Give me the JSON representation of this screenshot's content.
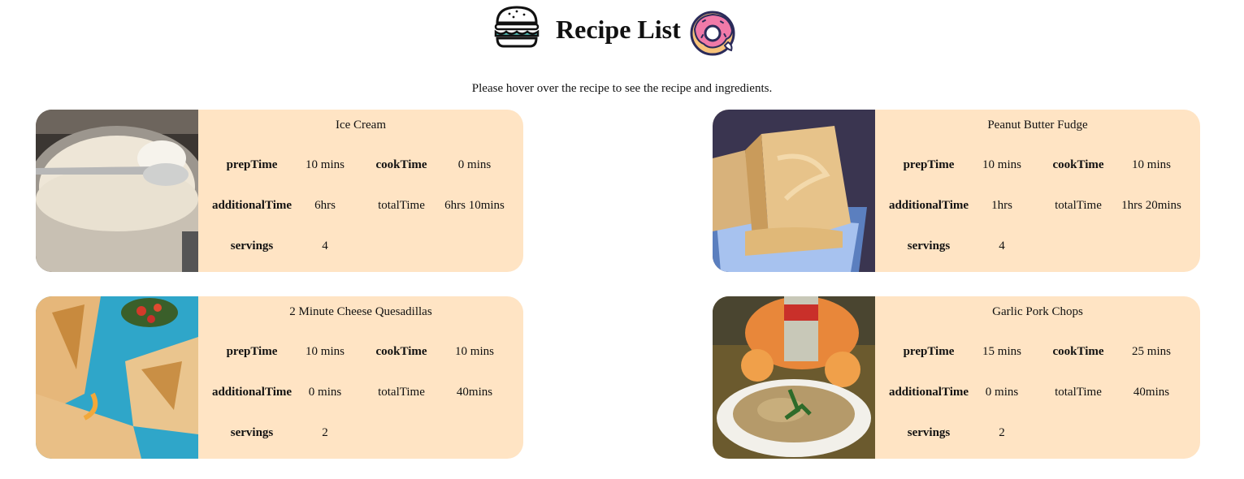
{
  "header": {
    "title": "Recipe List",
    "left_icon": "burger-icon",
    "right_icon": "donut-icon"
  },
  "subtitle": "Please hover over the recipe to see the recipe and ingredients.",
  "labels": {
    "prepTime": "prepTime",
    "cookTime": "cookTime",
    "additionalTime": "additionalTime",
    "totalTime": "totalTime",
    "servings": "servings"
  },
  "recipes": [
    {
      "name": "Ice Cream",
      "prepTime": "10 mins",
      "cookTime": "0 mins",
      "additionalTime": "6hrs",
      "totalTime": "6hrs 10mins",
      "servings": "4",
      "image": "ice-cream-jar-photo"
    },
    {
      "name": "Peanut Butter Fudge",
      "prepTime": "10 mins",
      "cookTime": "10 mins",
      "additionalTime": "1hrs",
      "totalTime": "1hrs 20mins",
      "servings": "4",
      "image": "fudge-photo"
    },
    {
      "name": "2 Minute Cheese Quesadillas",
      "prepTime": "10 mins",
      "cookTime": "10 mins",
      "additionalTime": "0 mins",
      "totalTime": "40mins",
      "servings": "2",
      "image": "quesadillas-photo"
    },
    {
      "name": "Garlic Pork Chops",
      "prepTime": "15 mins",
      "cookTime": "25 mins",
      "additionalTime": "0 mins",
      "totalTime": "40mins",
      "servings": "2",
      "image": "pork-chops-photo"
    }
  ],
  "colors": {
    "card_background": "#ffe4c4",
    "page_background": "#ffffff"
  }
}
